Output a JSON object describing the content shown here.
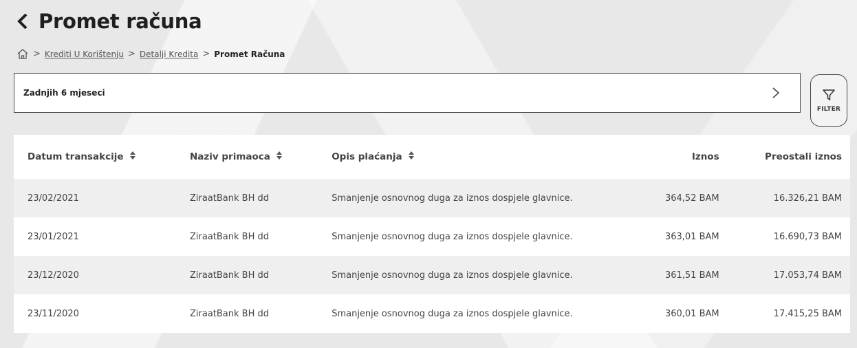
{
  "header": {
    "title": "Promet računa",
    "back_icon": "chevron-left-icon"
  },
  "breadcrumb": {
    "home_icon": "home-icon",
    "items": [
      {
        "label": "Krediti U Korištenju"
      },
      {
        "label": "Detalji Kredita"
      }
    ],
    "current": "Promet Računa",
    "separator": ">"
  },
  "period": {
    "label": "Zadnjih 6 mjeseci",
    "chevron_icon": "chevron-right-icon"
  },
  "filter": {
    "label": "FILTER",
    "icon": "funnel-icon"
  },
  "table": {
    "columns": [
      {
        "label": "Datum transakcije",
        "sortable": true
      },
      {
        "label": "Naziv primaoca",
        "sortable": true
      },
      {
        "label": "Opis plaćanja",
        "sortable": true
      },
      {
        "label": "Iznos",
        "sortable": false
      },
      {
        "label": "Preostali iznos",
        "sortable": false
      }
    ],
    "rows": [
      [
        "23/02/2021",
        "ZiraatBank BH dd",
        "Smanjenje osnovnog duga za iznos dospjele glavnice.",
        "364,52 BAM",
        "16.326,21 BAM"
      ],
      [
        "23/01/2021",
        "ZiraatBank BH dd",
        "Smanjenje osnovnog duga za iznos dospjele glavnice.",
        "363,01 BAM",
        "16.690,73 BAM"
      ],
      [
        "23/12/2020",
        "ZiraatBank BH dd",
        "Smanjenje osnovnog duga za iznos dospjele glavnice.",
        "361,51 BAM",
        "17.053,74 BAM"
      ],
      [
        "23/11/2020",
        "ZiraatBank BH dd",
        "Smanjenje osnovnog duga za iznos dospjele glavnice.",
        "360,01 BAM",
        "17.415,25 BAM"
      ]
    ]
  }
}
